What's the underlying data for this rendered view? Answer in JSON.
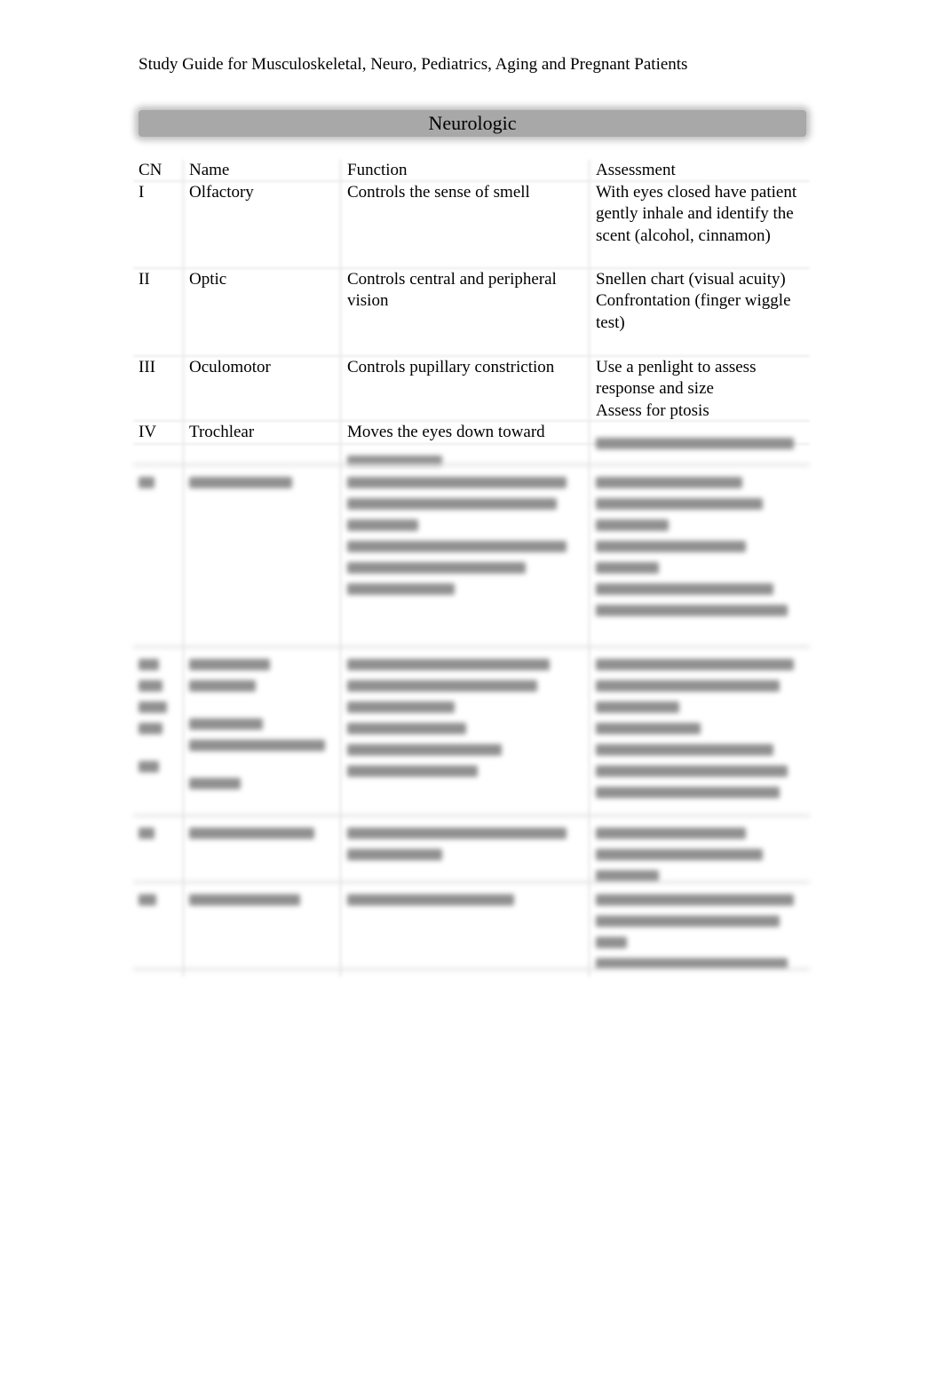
{
  "document": {
    "header": "Study Guide for Musculoskeletal, Neuro, Pediatrics, Aging and Pregnant Patients",
    "section_title": "Neurologic"
  },
  "table": {
    "columns": [
      "CN",
      "Name",
      "Function",
      "Assessment"
    ],
    "rows": [
      {
        "cn": "I",
        "name": "Olfactory",
        "function": "Controls the sense of smell",
        "assessment": "With eyes closed have patient gently inhale and identify the scent (alcohol, cinnamon)"
      },
      {
        "cn": "II",
        "name": "Optic",
        "function": "Controls central and peripheral vision",
        "assessment": "Snellen chart (visual acuity)\nConfrontation (finger wiggle test)"
      },
      {
        "cn": "III",
        "name": "Oculomotor",
        "function": "Controls pupillary constriction",
        "assessment": "Use a penlight to assess response and size\nAssess for ptosis"
      },
      {
        "cn": "IV",
        "name": "Trochlear",
        "function": "Moves the eyes down toward",
        "assessment": ""
      }
    ],
    "blurred_note": "Remaining rows are blurred and illegible"
  }
}
